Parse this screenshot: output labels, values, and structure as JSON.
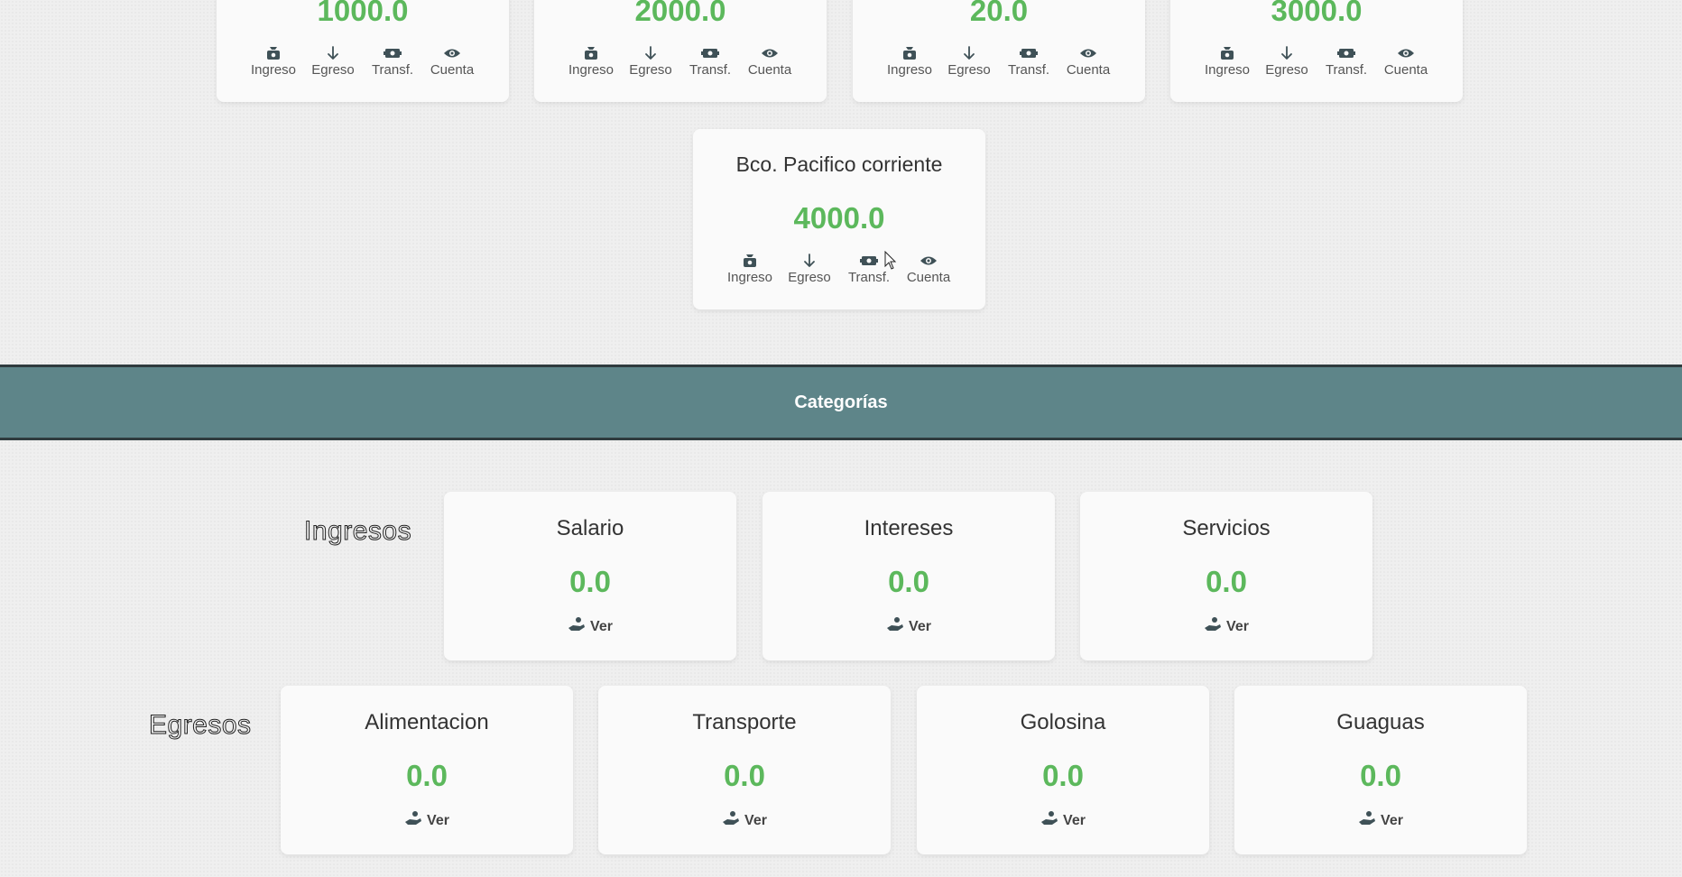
{
  "accounts": [
    {
      "amount": "1000.0"
    },
    {
      "amount": "2000.0"
    },
    {
      "amount": "20.0"
    },
    {
      "amount": "3000.0"
    },
    {
      "name": "Bco. Pacifico corriente",
      "amount": "4000.0"
    }
  ],
  "account_actions": {
    "income": {
      "label": "Ingreso",
      "icon": "money-bag-icon"
    },
    "expense": {
      "label": "Egreso",
      "icon": "arrow-down-icon"
    },
    "transfer": {
      "label": "Transf.",
      "icon": "transfer-money-icon"
    },
    "account": {
      "label": "Cuenta",
      "icon": "eye-icon"
    }
  },
  "banner": {
    "title": "Categorías",
    "color": "#5e8589"
  },
  "income_section": {
    "label": "Ingresos",
    "categories": [
      {
        "name": "Salario",
        "amount": "0.0",
        "action": "Ver"
      },
      {
        "name": "Intereses",
        "amount": "0.0",
        "action": "Ver"
      },
      {
        "name": "Servicios",
        "amount": "0.0",
        "action": "Ver"
      }
    ]
  },
  "expense_section": {
    "label": "Egresos",
    "categories": [
      {
        "name": "Alimentacion",
        "amount": "0.0",
        "action": "Ver"
      },
      {
        "name": "Transporte",
        "amount": "0.0",
        "action": "Ver"
      },
      {
        "name": "Golosina",
        "amount": "0.0",
        "action": "Ver"
      },
      {
        "name": "Guaguas",
        "amount": "0.0",
        "action": "Ver"
      }
    ]
  },
  "colors": {
    "amount": "#5cb85c",
    "card": "#fafafa",
    "background": "#efefef"
  }
}
